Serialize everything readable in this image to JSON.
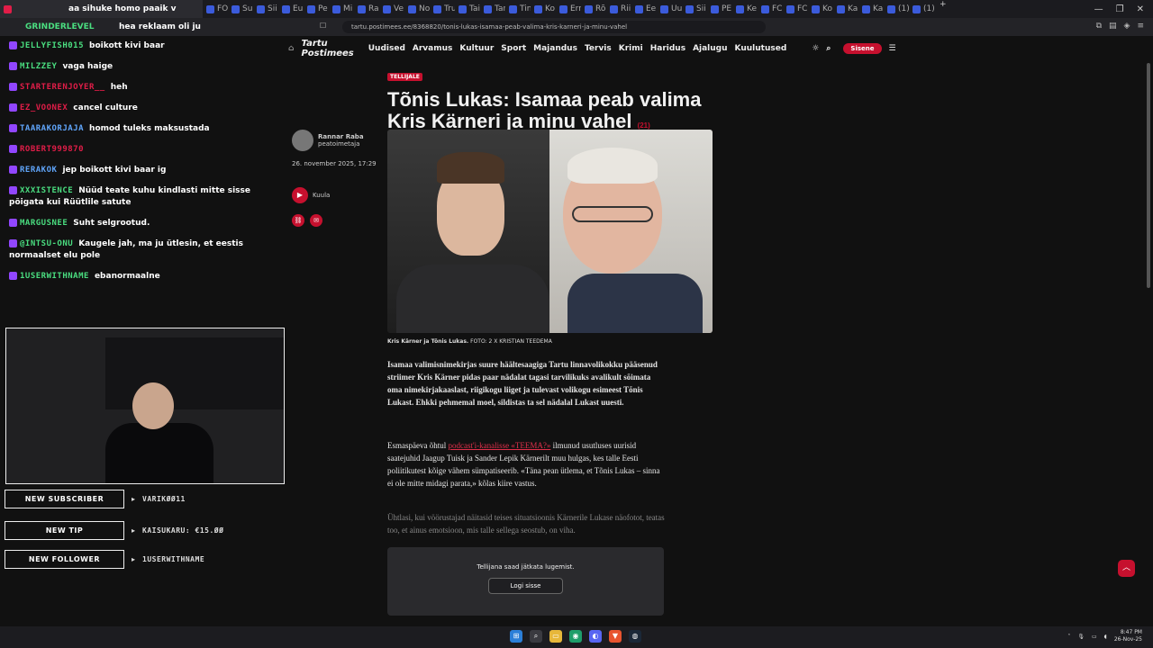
{
  "tabs": [
    {
      "label": "aa sihuke homo paaik v",
      "active": true
    },
    {
      "label": "FO"
    },
    {
      "label": "Su"
    },
    {
      "label": "Sii"
    },
    {
      "label": "Eu"
    },
    {
      "label": "Pe"
    },
    {
      "label": "Mi"
    },
    {
      "label": "Ra"
    },
    {
      "label": "Ve"
    },
    {
      "label": "No"
    },
    {
      "label": "Tru"
    },
    {
      "label": "Tai"
    },
    {
      "label": "Tar"
    },
    {
      "label": "Tin"
    },
    {
      "label": "Ko"
    },
    {
      "label": "Ern"
    },
    {
      "label": "Rõ"
    },
    {
      "label": "Rii"
    },
    {
      "label": "Ee"
    },
    {
      "label": "Uu"
    },
    {
      "label": "Sii"
    },
    {
      "label": "PE"
    },
    {
      "label": "Ke"
    },
    {
      "label": "FC"
    },
    {
      "label": "FC"
    },
    {
      "label": "Ko"
    },
    {
      "label": "Ka"
    },
    {
      "label": "Ka"
    },
    {
      "label": "(1)"
    },
    {
      "label": "(1)"
    }
  ],
  "address": {
    "url": "tartu.postimees.ee/8368820/tonis-lukas-isamaa-peab-valima-kris-karneri-ja-minu-vahel"
  },
  "chat_overlay": {
    "top_message": {
      "user": "GRINDERLEVEL",
      "text": "hea reklaam oli ju"
    },
    "messages": [
      {
        "user": "JELLYFISH015",
        "text": "boikott kivi baar",
        "color": "#4ade80"
      },
      {
        "user": "MILZZEY",
        "text": "vaga haige",
        "color": "#4ade80"
      },
      {
        "user": "STARTERENJOYER__",
        "text": "heh",
        "color": "#e11d48"
      },
      {
        "user": "EZ_VOONEX",
        "text": "cancel culture",
        "color": "#e11d48"
      },
      {
        "user": "TAARAKORJAJA",
        "text": "homod tuleks maksustada",
        "color": "#60a5fa"
      },
      {
        "user": "ROBERT999870",
        "text": "",
        "color": "#e11d48"
      },
      {
        "user": "RERAKOK",
        "text": "jep boikott kivi baar ig",
        "color": "#60a5fa"
      },
      {
        "user": "XXXISTENCE",
        "text": "Nüüd teate kuhu kindlasti mitte sisse põigata kui Rüütlile satute",
        "color": "#4ade80"
      },
      {
        "user": "MARGUSNEE",
        "text": "Suht selgrootud.",
        "color": "#4ade80"
      },
      {
        "user": "@INTSU-ONU",
        "text": "Kaugele jah, ma ju ütlesin, et eestis normaalset elu pole",
        "color": "#4ade80"
      },
      {
        "user": "1USERWITHNAME",
        "text": "ebanormaalne",
        "color": "#4ade80"
      }
    ],
    "alerts": [
      {
        "label": "NEW SUBSCRIBER",
        "value": "VARIKØØ11"
      },
      {
        "label": "NEW TIP",
        "value": "KAISUKARU: €15.ØØ"
      },
      {
        "label": "NEW FOLLOWER",
        "value": "1USERWITHNAME"
      }
    ]
  },
  "site_nav": {
    "logo": "Tartu Postimees",
    "items": [
      "Uudised",
      "Arvamus",
      "Kultuur",
      "Sport",
      "Majandus",
      "Tervis",
      "Krimi",
      "Haridus",
      "Ajalugu",
      "Kuulutused"
    ],
    "signin": "Sisene"
  },
  "byline": {
    "author": "Rannar Raba",
    "role": "peatoimetaja",
    "date": "26. november 2025, 17:29",
    "listen": "Kuula"
  },
  "article": {
    "tag": "TELLIJALE",
    "title": "Tõnis Lukas: Isamaa peab valima Kris Kärneri ja minu vahel",
    "comments": "(21)",
    "caption_names": "Kris Kärner ja Tõnis Lukas.",
    "caption_credit": "FOTO: 2 X KRISTIAN TEEDEMA",
    "lead": "Isamaa valimisnimekirjas suure häältesaagiga Tartu linnavolikokku pääsenud striimer Kris Kärner pidas paar nädalat tagasi tarvilikuks avalikult sõimata oma nimekirjakaaslast, riigikogu liiget ja tulevast volikogu esimeest Tõnis Lukast. Ehkki pehmemal moel, sildistas ta sel nädalal Lukast uuesti.",
    "p2_before": "Esmaspäeva õhtul ",
    "p2_link": "podcast'i-kanalisse «TEEMA?»",
    "p2_after": " ilmunud usutluses uurisid saatejuhid Jaagup Tuisk ja Sander Lepik Kärnerilt muu hulgas, kes talle Eesti poliitikutest kõige vähem sümpatiseerib. «Täna pean ütlema, et Tõnis Lukas – sinna ei ole mitte midagi parata,» kõlas kiire vastus.",
    "p3": "Ühtlasi, kui vöörustajad näitasid teises situatsioonis Kärnerile Lukase näofotot, teatas too, et ainus emotsioon, mis talle sellega seostub, on viha."
  },
  "paywall": {
    "text": "Tellijana saad jätkata lugemist.",
    "button": "Logi sisse"
  },
  "taskbar": {
    "time": "8:47 PM",
    "date": "26-Nov-25"
  }
}
